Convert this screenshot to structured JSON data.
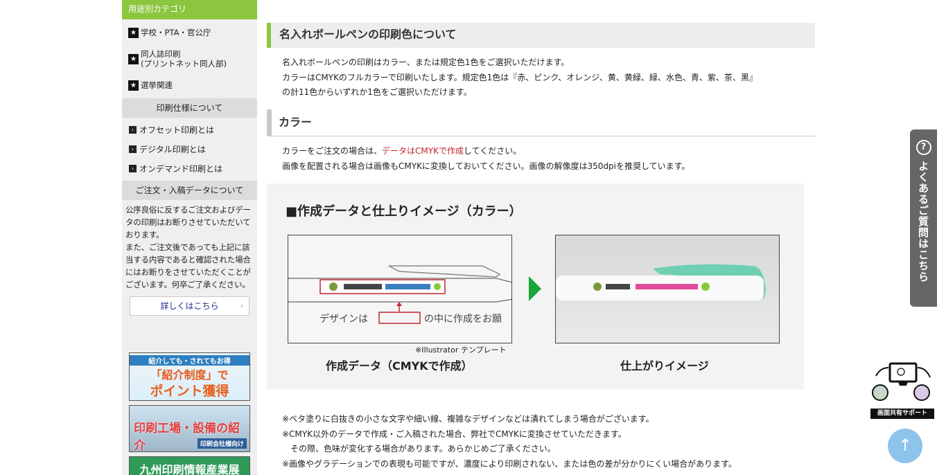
{
  "sidebar": {
    "category_heading": "用途別カテゴリ",
    "categories": [
      {
        "label": "学校・PTA・官公庁"
      },
      {
        "label": "同人誌印刷\n(プリントネット同人部)"
      },
      {
        "label": "選挙関連"
      }
    ],
    "spec_heading": "印刷仕様について",
    "spec_items": [
      {
        "label": "オフセット印刷とは"
      },
      {
        "label": "デジタル印刷とは"
      },
      {
        "label": "オンデマンド印刷とは"
      }
    ],
    "order_heading": "ご注文・入稿データについて",
    "order_notice": "公序良俗に反するご注文およびデータの印刷はお断りさせていただいております。\nまた、ご注文後であっても上記に該当する内容であると確認された場合にはお断りをさせていただくことがございます。何卒ご了承ください。",
    "detail_button": "詳しくはこちら",
    "banners": {
      "referral_top": "紹介しても・されてもお得",
      "referral_main": "「紹介制度」で",
      "referral_sub": "ポイント獲得",
      "factory_main": "印刷工場・設備の紹介",
      "factory_tag": "印刷会社様向け",
      "expo": "九州印刷情報産業展"
    }
  },
  "main": {
    "heading": "名入れボールペンの印刷色について",
    "intro_lines": [
      "名入れボールペンの印刷はカラー、または規定色1色をご選択いただけます。",
      "カラーはCMYKのフルカラーで印刷いたします。規定色1色は『赤、ピンク、オレンジ、黄、黄緑、緑、水色、青、紫、茶、黒』",
      "の計11色からいずれか1色をご選択いただけます。"
    ],
    "color_heading": "カラー",
    "color_line1_before": "カラーをご注文の場合は、",
    "color_line1_red": "データはCMYKで作成",
    "color_line1_after": "してください。",
    "color_line2": "画像を配置される場合は画像もCMYKに変換しておいてください。画像の解像度は350dpiを推奨しています。",
    "figure": {
      "title": "■作成データと仕上りイメージ（カラー）",
      "design_label": "デザインは",
      "design_label2": "の中に作成をお願",
      "template_note": "※Illustrator テンプレート",
      "caption_left": "作成データ（CMYKで作成）",
      "caption_right": "仕上がりイメージ"
    },
    "notes": [
      "※ベタ塗りに白抜きの小さな文字や細い線、複雑なデザインなどは潰れてしまう場合がございます。",
      "※CMYK以外のデータで作成・ご入稿された場合、弊社でCMYKに変換させていただきます。",
      "　その際、色味が変化する場合があります。あらかじめご了承ください。",
      "※画像やグラデーションでの表現も可能ですが、濃度により印刷されない、または色の差が分かりにくい場合があります。"
    ]
  },
  "floating": {
    "faq_label": "よくあるご質問はこちら",
    "support_label": "画面共有サポート",
    "to_top": "↑"
  },
  "colors": {
    "accent_green": "#8cc63f",
    "emphasis_red": "#c0262c",
    "arrow_green": "#18a53a"
  }
}
